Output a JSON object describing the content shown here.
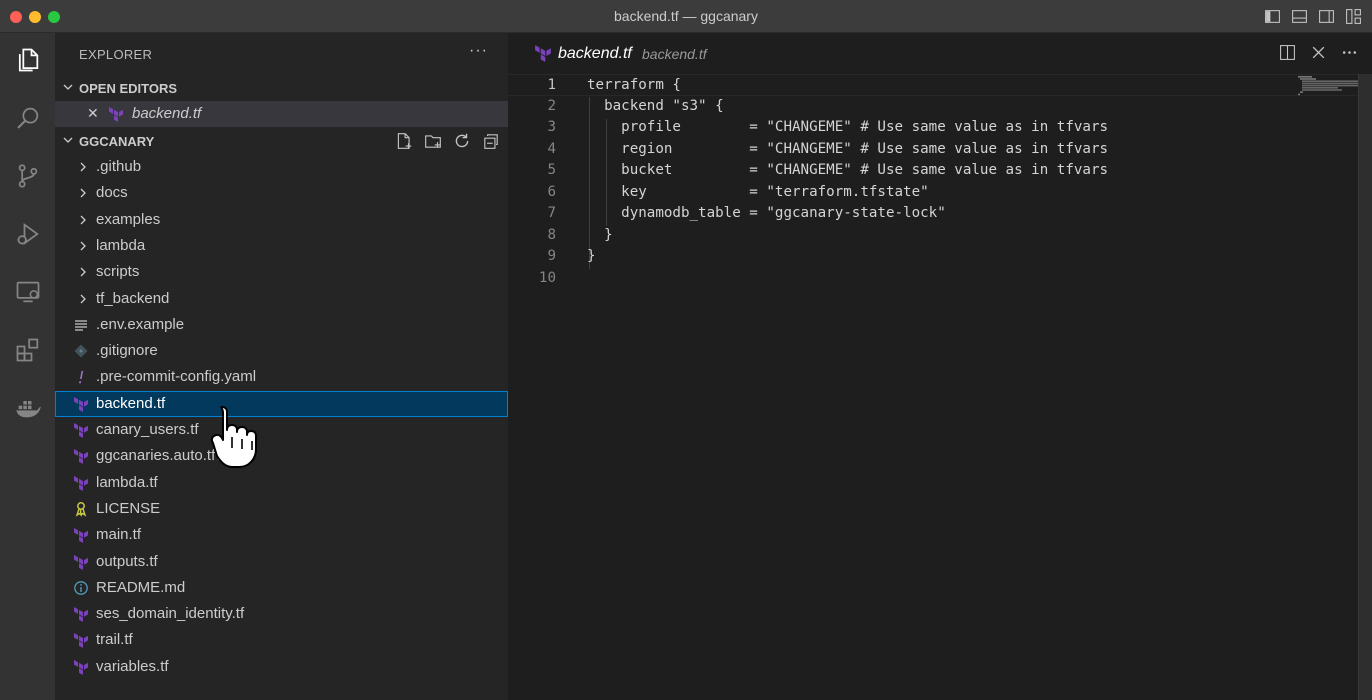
{
  "window": {
    "title": "backend.tf — ggcanary"
  },
  "colors": {
    "terraform": "#7b42bc",
    "selection_bg": "#04395e",
    "selection_border": "#007fd4",
    "license": "#cbcb41",
    "info": "#519aba",
    "yaml": "#a074c4"
  },
  "activity_bar": [
    "files-icon",
    "search-icon",
    "source-control-icon",
    "run-debug-icon",
    "remote-explorer-icon",
    "extensions-icon",
    "docker-icon"
  ],
  "sidebar": {
    "title": "EXPLORER",
    "more": "···",
    "open_editors": {
      "label": "OPEN EDITORS",
      "items": [
        {
          "close": "✕",
          "name": "backend.tf"
        }
      ]
    },
    "workspace": {
      "label": "GGCANARY",
      "items": [
        {
          "name": ".github",
          "type": "folder"
        },
        {
          "name": "docs",
          "type": "folder"
        },
        {
          "name": "examples",
          "type": "folder"
        },
        {
          "name": "lambda",
          "type": "folder"
        },
        {
          "name": "scripts",
          "type": "folder"
        },
        {
          "name": "tf_backend",
          "type": "folder"
        },
        {
          "name": ".env.example",
          "type": "text"
        },
        {
          "name": ".gitignore",
          "type": "git"
        },
        {
          "name": ".pre-commit-config.yaml",
          "type": "yaml"
        },
        {
          "name": "backend.tf",
          "type": "tf",
          "selected": true
        },
        {
          "name": "canary_users.tf",
          "type": "tf"
        },
        {
          "name": "ggcanaries.auto.tfvars",
          "type": "tf"
        },
        {
          "name": "lambda.tf",
          "type": "tf"
        },
        {
          "name": "LICENSE",
          "type": "license"
        },
        {
          "name": "main.tf",
          "type": "tf"
        },
        {
          "name": "outputs.tf",
          "type": "tf"
        },
        {
          "name": "README.md",
          "type": "info"
        },
        {
          "name": "ses_domain_identity.tf",
          "type": "tf"
        },
        {
          "name": "trail.tf",
          "type": "tf"
        },
        {
          "name": "variables.tf",
          "type": "tf"
        }
      ]
    }
  },
  "editor": {
    "tab": {
      "name": "backend.tf",
      "description": "backend.tf"
    },
    "active_line": 1,
    "lines": [
      {
        "n": "1",
        "text": "terraform {"
      },
      {
        "n": "2",
        "text": "  backend \"s3\" {"
      },
      {
        "n": "3",
        "text": "    profile        = \"CHANGEME\" # Use same value as in tfvars"
      },
      {
        "n": "4",
        "text": "    region         = \"CHANGEME\" # Use same value as in tfvars"
      },
      {
        "n": "5",
        "text": "    bucket         = \"CHANGEME\" # Use same value as in tfvars"
      },
      {
        "n": "6",
        "text": "    key            = \"terraform.tfstate\""
      },
      {
        "n": "7",
        "text": "    dynamodb_table = \"ggcanary-state-lock\""
      },
      {
        "n": "8",
        "text": "  }"
      },
      {
        "n": "9",
        "text": "}"
      },
      {
        "n": "10",
        "text": ""
      }
    ]
  }
}
